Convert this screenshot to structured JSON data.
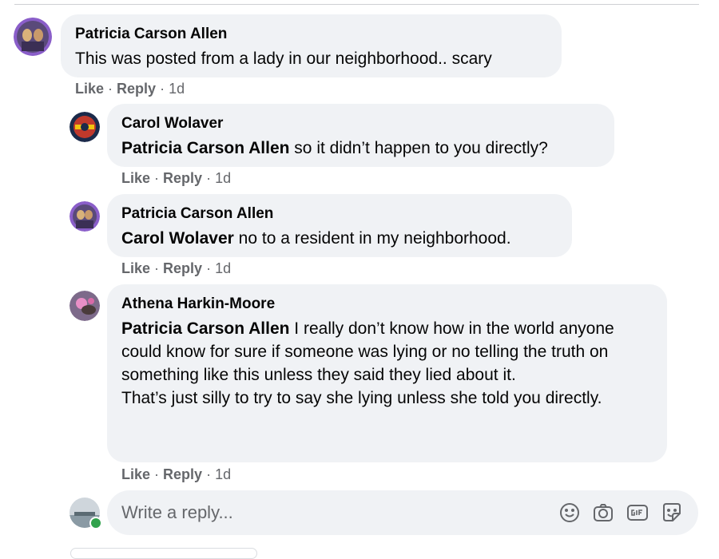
{
  "comments": [
    {
      "author": "Patricia Carson Allen",
      "text": "This was posted from a lady in our neighborhood.. scary",
      "actions": {
        "like": "Like",
        "reply": "Reply",
        "time": "1d"
      }
    },
    {
      "author": "Carol Wolaver",
      "mention": "Patricia Carson Allen",
      "text": " so it didn’t happen to you directly?",
      "actions": {
        "like": "Like",
        "reply": "Reply",
        "time": "1d"
      }
    },
    {
      "author": "Patricia Carson Allen",
      "mention": "Carol Wolaver",
      "text": " no to a resident in my neighborhood.",
      "actions": {
        "like": "Like",
        "reply": "Reply",
        "time": "1d"
      }
    },
    {
      "author": "Athena Harkin-Moore",
      "mention": "Patricia Carson Allen",
      "text": " I really don’t know how in the world anyone could know for sure if someone was lying or no telling the truth on something like this unless they said they lied about it.",
      "text2": "That’s just silly to try to say she lying unless she told you directly.",
      "actions": {
        "like": "Like",
        "reply": "Reply",
        "time": "1d"
      }
    }
  ],
  "reply_box": {
    "placeholder": "Write a reply...",
    "icons": [
      "emoji-icon",
      "camera-icon",
      "gif-icon",
      "sticker-icon"
    ]
  },
  "separator": "·",
  "colors": {
    "bubble": "#f0f2f5",
    "secondary_text": "#65676b",
    "online": "#31a24c"
  }
}
